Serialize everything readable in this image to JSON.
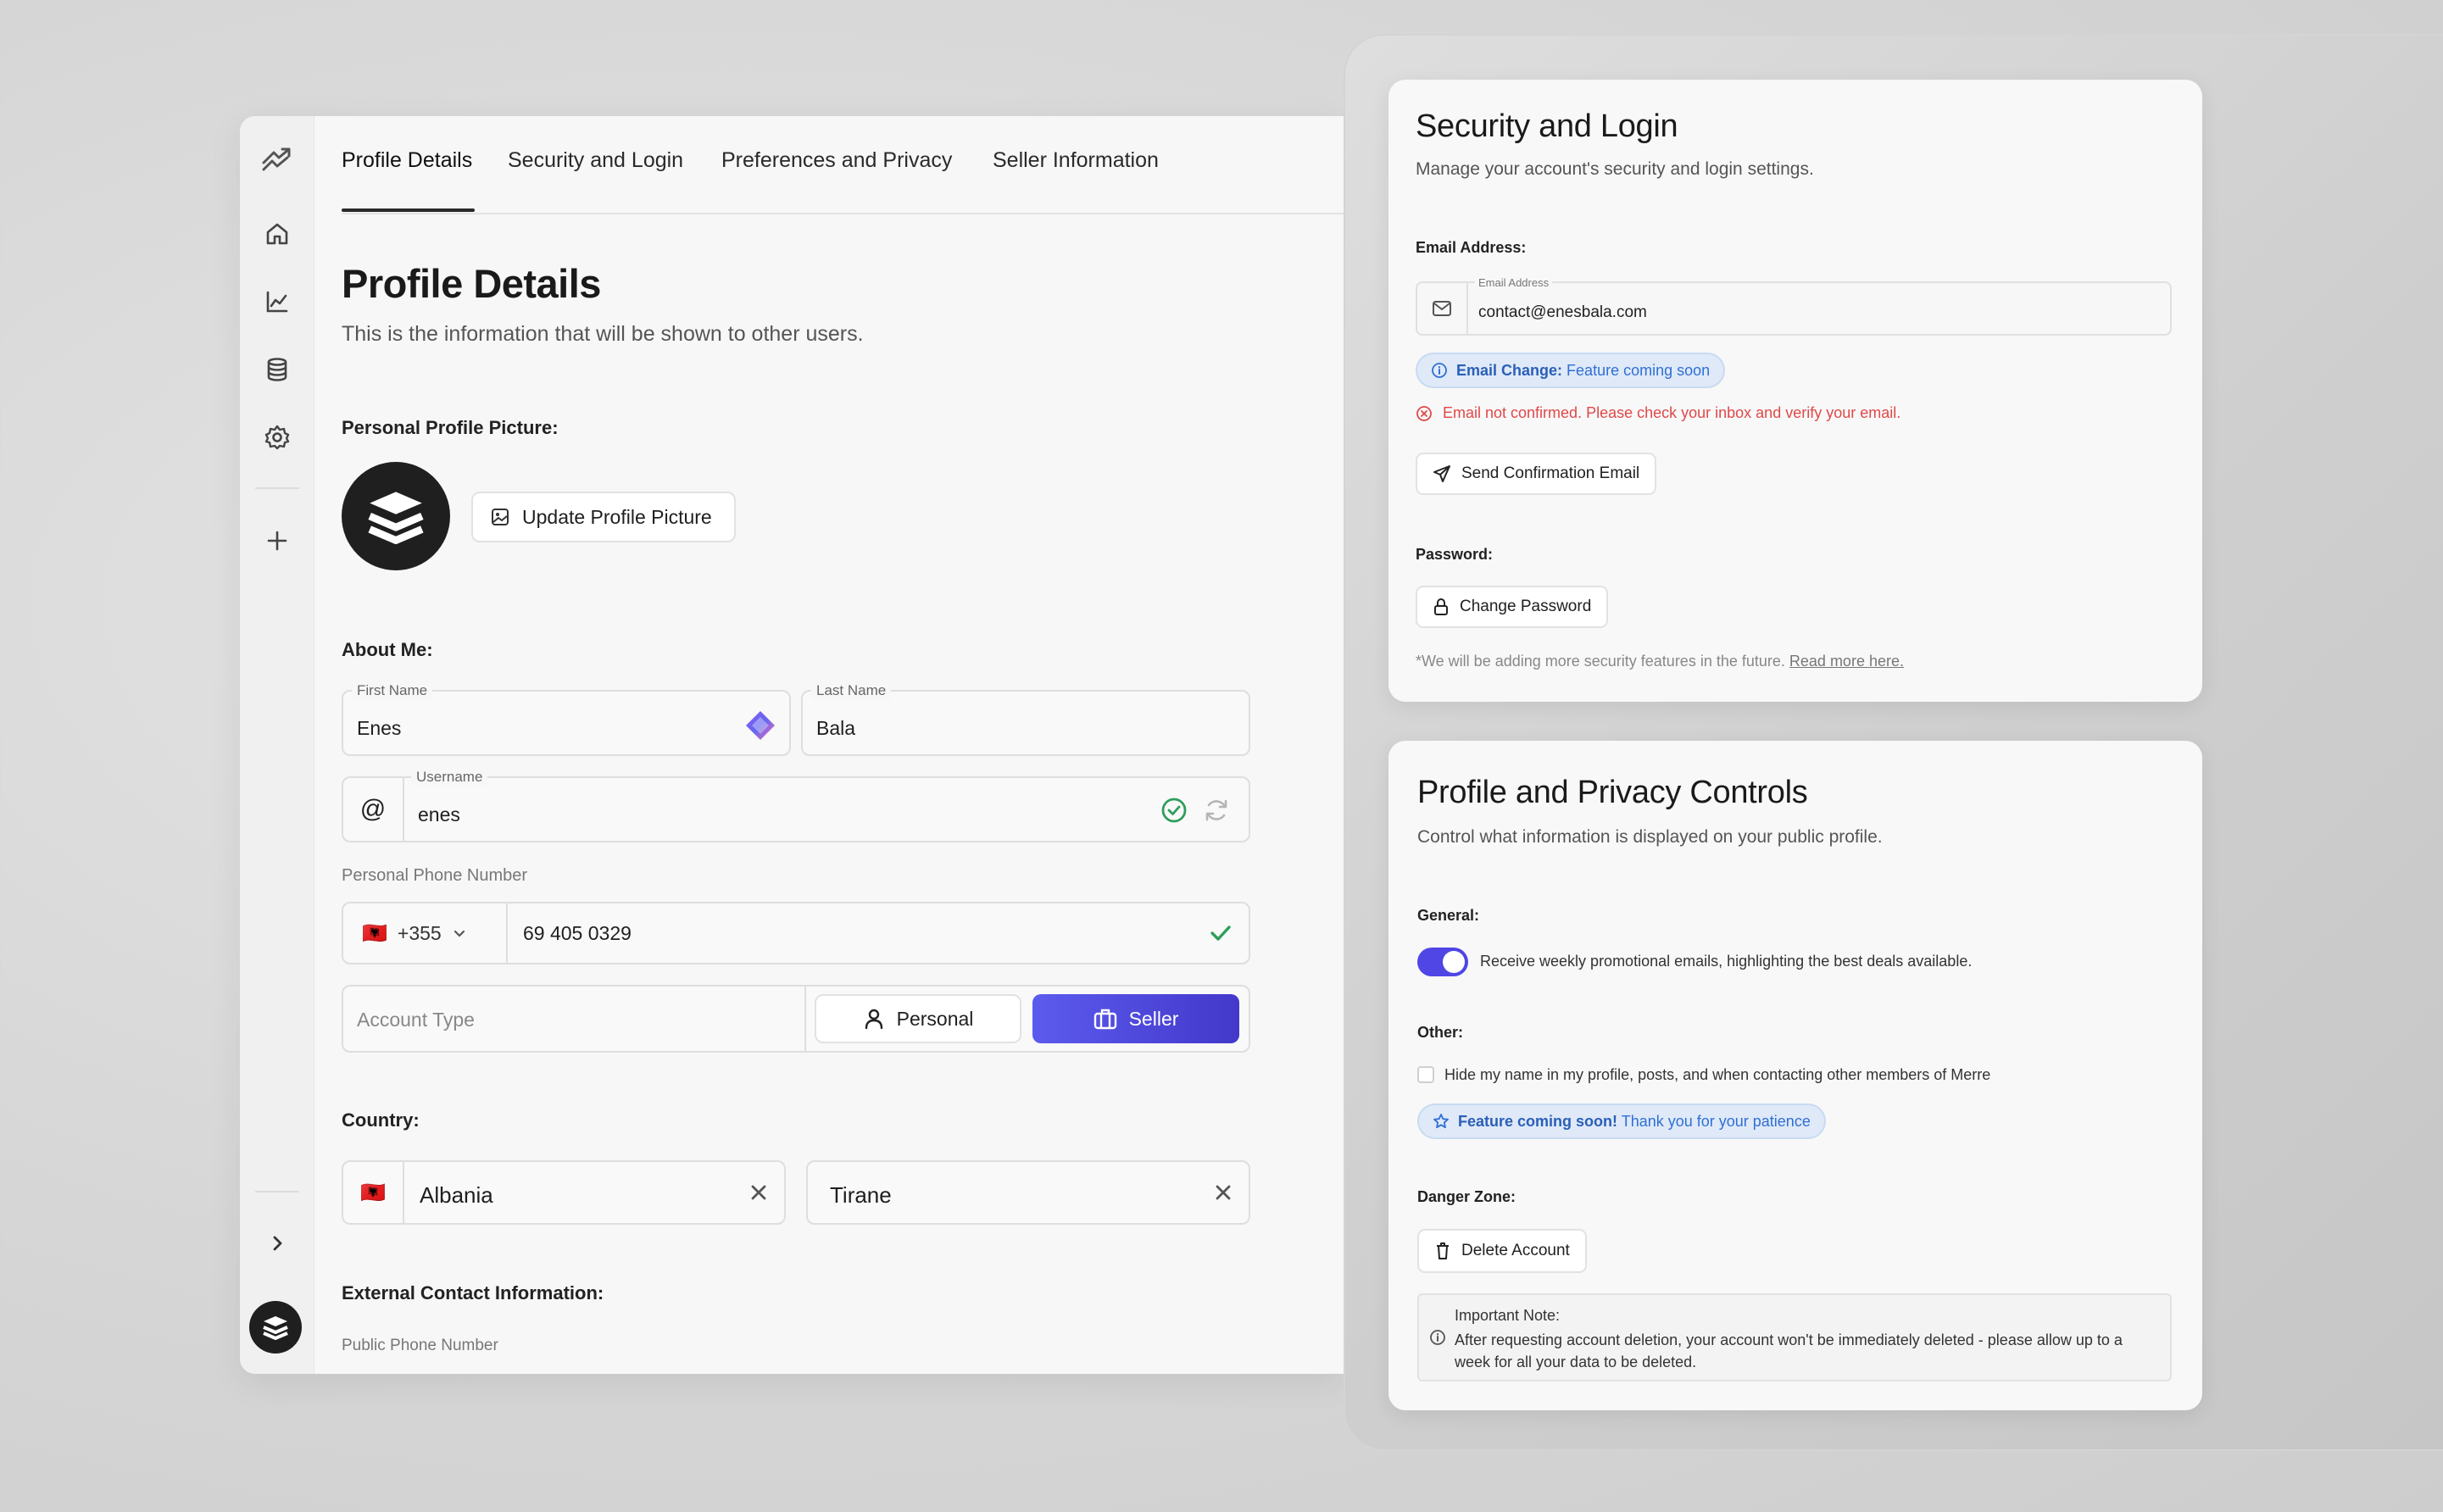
{
  "tabs": [
    "Profile Details",
    "Security and Login",
    "Preferences and Privacy",
    "Seller Information"
  ],
  "profile": {
    "title": "Profile Details",
    "subtitle": "This is the information that will be shown to other users.",
    "picture_label": "Personal Profile Picture:",
    "update_picture_button": "Update Profile Picture",
    "about_label": "About Me:",
    "first_name_label": "First Name",
    "first_name_value": "Enes",
    "last_name_label": "Last Name",
    "last_name_value": "Bala",
    "username_label": "Username",
    "username_value": "enes",
    "phone_label": "Personal Phone Number",
    "phone_flag": "🇦🇱",
    "phone_code": "+355",
    "phone_value": "69 405 0329",
    "account_type_placeholder": "Account Type",
    "account_type_options": [
      "Personal",
      "Seller"
    ],
    "account_type_selected": "Seller",
    "country_label": "Country:",
    "country_flag": "🇦🇱",
    "country_value": "Albania",
    "city_value": "Tirane",
    "external_contact_label": "External Contact Information:",
    "public_phone_label": "Public Phone Number"
  },
  "security": {
    "title": "Security and Login",
    "subtitle": "Manage your account's security and login settings.",
    "email_section_label": "Email Address:",
    "email_field_label": "Email Address",
    "email_value": "contact@enesbala.com",
    "email_change_bold": "Email Change:",
    "email_change_text": "Feature coming soon",
    "email_error": "Email not confirmed. Please check your inbox and verify your email.",
    "send_confirmation_button": "Send Confirmation Email",
    "password_label": "Password:",
    "change_password_button": "Change Password",
    "footnote": "*We will be adding more security features in the future.",
    "footnote_link": "Read more here."
  },
  "privacy": {
    "title": "Profile and Privacy Controls",
    "subtitle": "Control what information is displayed on your public profile.",
    "general_label": "General:",
    "toggle_text": "Receive weekly promotional emails, highlighting the best deals available.",
    "toggle_on": true,
    "other_label": "Other:",
    "checkbox_text": "Hide my name in my profile, posts, and when contacting other members of Merre",
    "checkbox_checked": false,
    "coming_soon_bold": "Feature coming soon!",
    "coming_soon_text": "Thank you for your patience",
    "danger_label": "Danger Zone:",
    "delete_button": "Delete Account",
    "note_title": "Important Note:",
    "note_text": "After requesting account deletion, your account won't be immediately deleted - please allow up to a week for all your data to be deleted."
  },
  "colors": {
    "accent": "#4f46e5",
    "success": "#2e9e5b",
    "error": "#e04848",
    "info": "#2f6fd6"
  }
}
